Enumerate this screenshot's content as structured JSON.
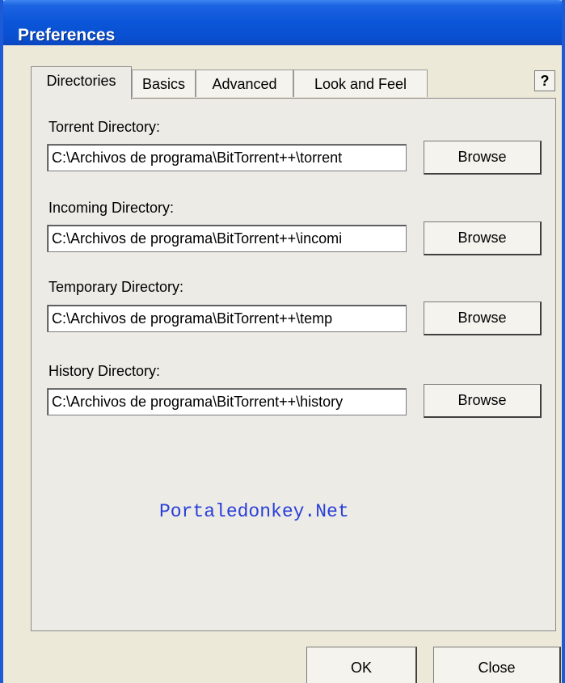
{
  "window": {
    "title": "Preferences",
    "help_label": "?"
  },
  "tabs": [
    {
      "label": "Directories",
      "active": true
    },
    {
      "label": "Basics",
      "active": false
    },
    {
      "label": "Advanced",
      "active": false
    },
    {
      "label": "Look and Feel",
      "active": false
    }
  ],
  "directories": [
    {
      "label": "Torrent Directory:",
      "value": "C:\\Archivos de programa\\BitTorrent++\\torrent",
      "button": "Browse"
    },
    {
      "label": "Incoming Directory:",
      "value": "C:\\Archivos de programa\\BitTorrent++\\incomi",
      "button": "Browse"
    },
    {
      "label": "Temporary Directory:",
      "value": "C:\\Archivos de programa\\BitTorrent++\\temp",
      "button": "Browse"
    },
    {
      "label": "History Directory:",
      "value": "C:\\Archivos de programa\\BitTorrent++\\history",
      "button": "Browse"
    }
  ],
  "watermark": "Portaledonkey.Net",
  "footer": {
    "ok_label": "OK",
    "close_label": "Close"
  },
  "colors": {
    "titlebar": "#0a55d8",
    "dialog_bg": "#ece9d8",
    "watermark": "#2a3fd8"
  }
}
